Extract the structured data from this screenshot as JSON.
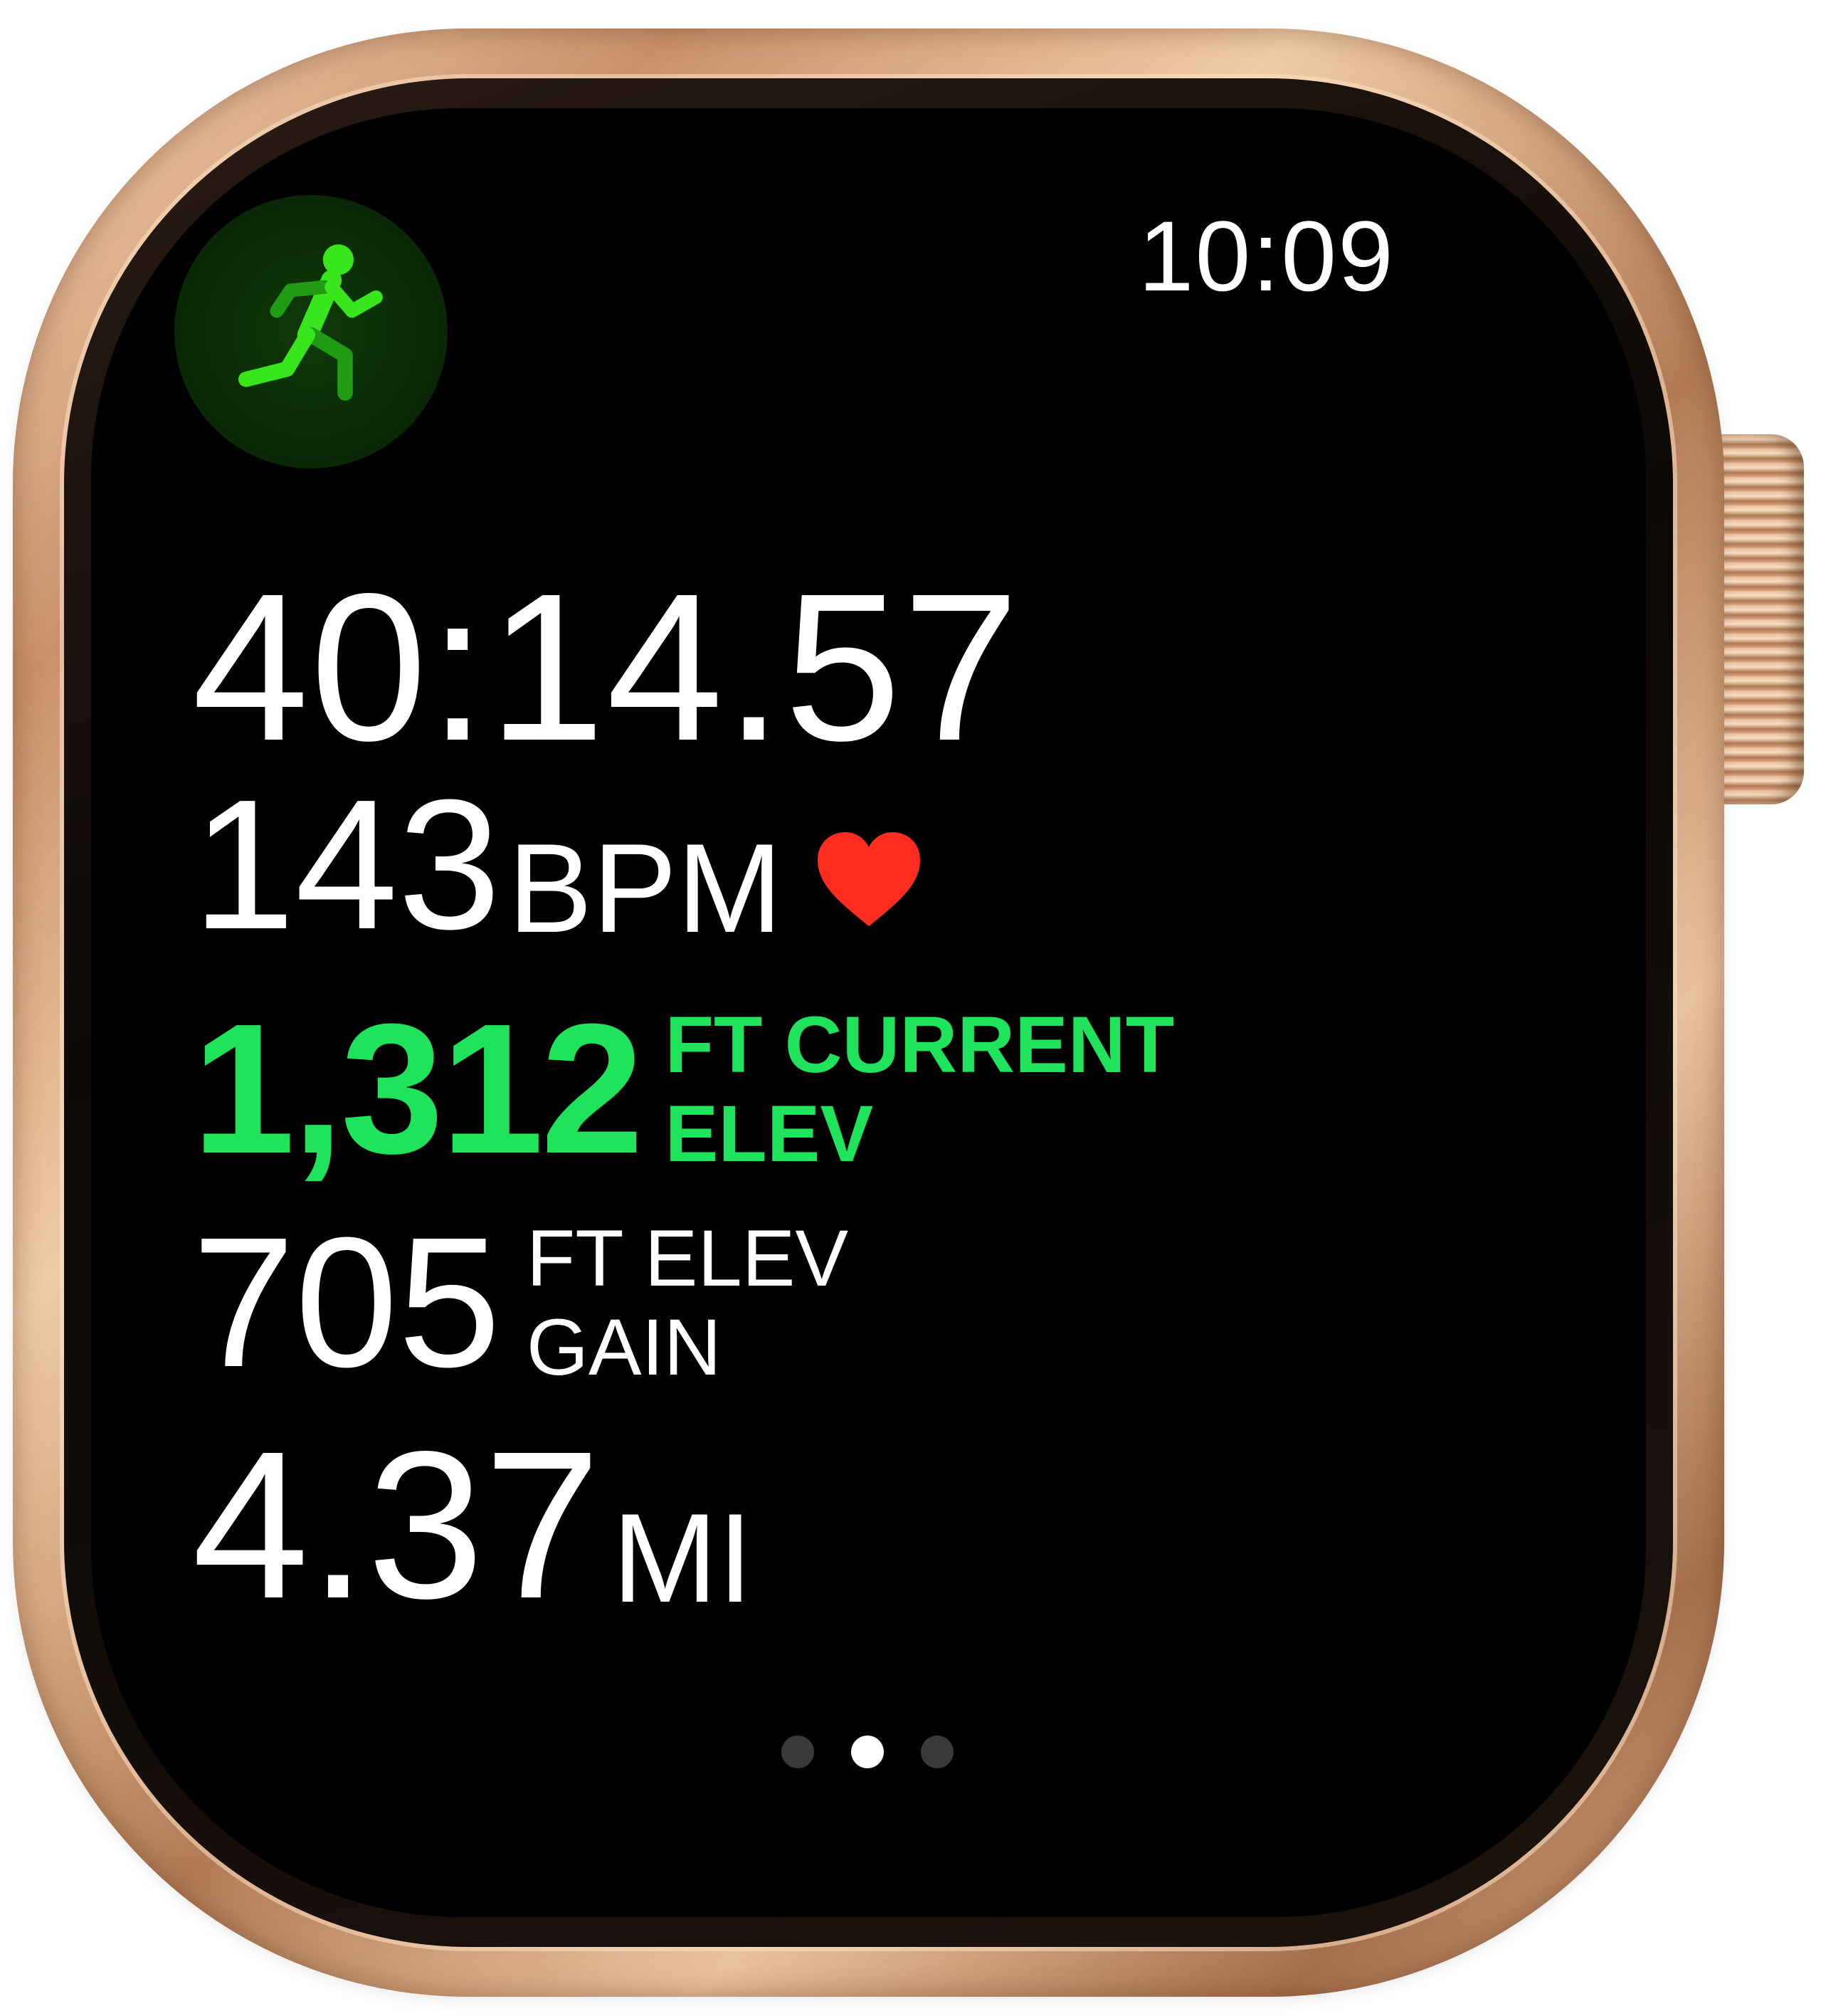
{
  "status": {
    "time": "10:09"
  },
  "workout": {
    "icon": "outdoor-run-icon",
    "accent_color": "#1fe35a"
  },
  "metrics": {
    "duration": "40:14.57",
    "heart_rate": {
      "value": "143",
      "unit": "BPM",
      "icon": "heart-icon",
      "icon_color": "#ff2d20"
    },
    "current_elevation": {
      "value": "1,312",
      "unit_line1": "FT CURRENT",
      "unit_line2": "ELEV",
      "color": "#1fe35a"
    },
    "elevation_gain": {
      "value": "705",
      "unit_line1": "FT ELEV",
      "unit_line2": "GAIN"
    },
    "distance": {
      "value": "4.37",
      "unit": "MI"
    }
  },
  "pager": {
    "page_count": 3,
    "current_page": 2
  }
}
